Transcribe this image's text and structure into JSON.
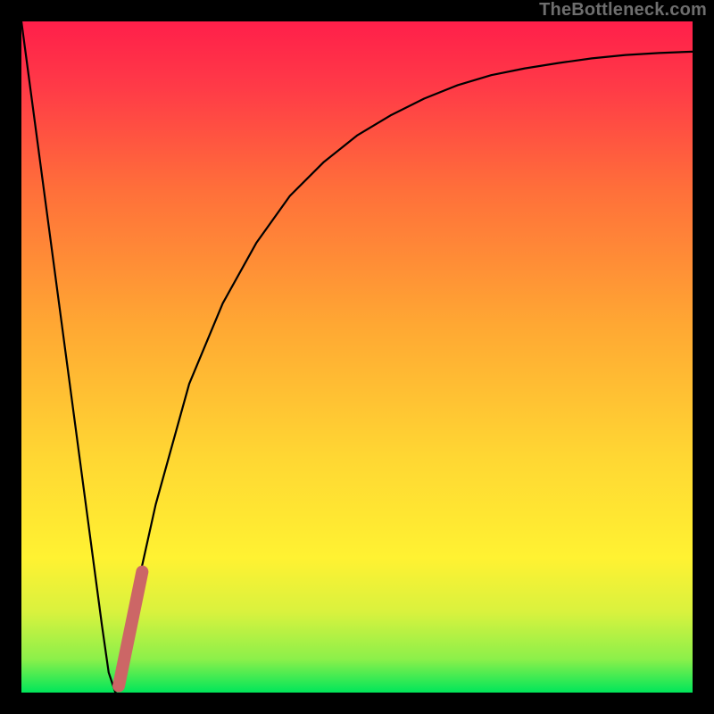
{
  "watermark": "TheBottleneck.com",
  "chart_data": {
    "type": "line",
    "title": "",
    "xlabel": "",
    "ylabel": "",
    "xlim": [
      0,
      100
    ],
    "ylim": [
      0,
      100
    ],
    "grid": false,
    "series": [
      {
        "name": "bottleneck-curve",
        "description": "Black V-shaped curve; left arm straight, right arm approaches an asymptote",
        "x": [
          0,
          2,
          4,
          6,
          8,
          10,
          12,
          13,
          14,
          15,
          16,
          18,
          20,
          25,
          30,
          35,
          40,
          45,
          50,
          55,
          60,
          65,
          70,
          75,
          80,
          85,
          90,
          95,
          100
        ],
        "y": [
          100,
          85,
          70,
          55,
          40,
          25,
          10,
          3,
          0,
          3,
          9,
          19,
          28,
          46,
          58,
          67,
          74,
          79,
          83,
          86,
          88.5,
          90.5,
          92,
          93,
          93.8,
          94.5,
          95,
          95.3,
          95.5
        ]
      },
      {
        "name": "highlight-segment",
        "description": "Thick salmon marker stroke near curve minimum on the rising side",
        "x": [
          14.5,
          18
        ],
        "y": [
          1,
          18
        ]
      }
    ],
    "background_gradient": {
      "stops": [
        {
          "pos": 0.0,
          "color": "#00e65a"
        },
        {
          "pos": 0.05,
          "color": "#8cf04a"
        },
        {
          "pos": 0.12,
          "color": "#d9f23e"
        },
        {
          "pos": 0.2,
          "color": "#fff232"
        },
        {
          "pos": 0.35,
          "color": "#ffd733"
        },
        {
          "pos": 0.55,
          "color": "#ffa733"
        },
        {
          "pos": 0.75,
          "color": "#ff6f3a"
        },
        {
          "pos": 0.9,
          "color": "#ff3b47"
        },
        {
          "pos": 1.0,
          "color": "#ff1f4a"
        }
      ]
    }
  }
}
